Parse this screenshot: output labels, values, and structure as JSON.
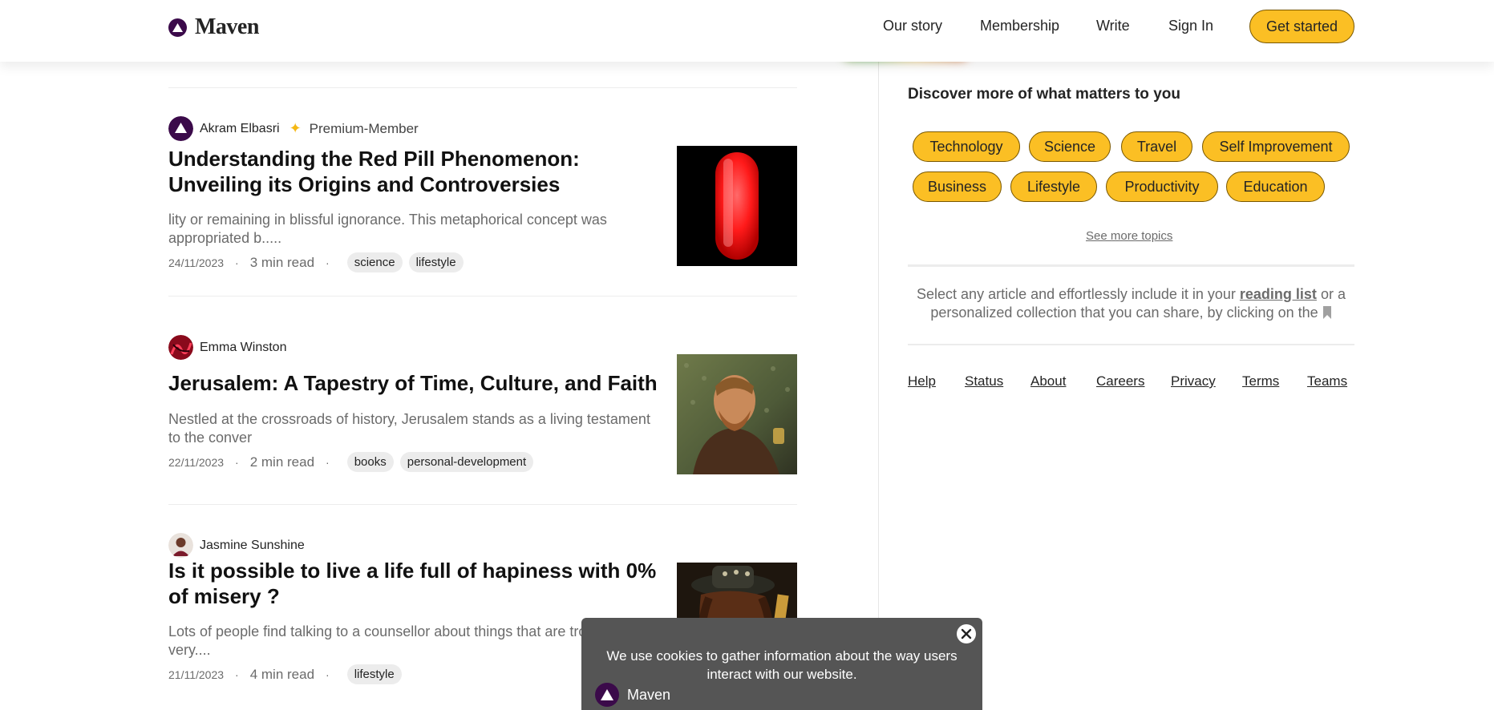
{
  "header": {
    "brand": "Maven",
    "nav": [
      {
        "label": "Our story"
      },
      {
        "label": "Membership"
      },
      {
        "label": "Write"
      },
      {
        "label": "Sign In"
      }
    ],
    "cta": "Get started"
  },
  "posts": [
    {
      "author": "Akram Elbasri",
      "badge": "Premium-Member",
      "title": "Understanding the Red Pill Phenomenon: Unveiling its Origins and Controversies",
      "excerpt": "lity or remaining in blissful ignorance. This metaphorical concept was appropriated b.....",
      "date": "24/11/2023",
      "read_time": "3 min read",
      "tags": [
        "science",
        "lifestyle"
      ],
      "image": "red-pill-image"
    },
    {
      "author": "Emma Winston",
      "title": "Jerusalem: A Tapestry of Time, Culture, and Faith",
      "excerpt": "Nestled at the crossroads of history, Jerusalem stands as a living testament to the conver",
      "date": "22/11/2023",
      "read_time": "2 min read",
      "tags": [
        "books",
        "personal-development"
      ],
      "image": "man-portrait-image"
    },
    {
      "author": "Jasmine Sunshine",
      "title": "Is it possible to live a life full of hapiness with 0% of misery ?",
      "excerpt": "Lots of people find talking to a counsellor about things that are troubling them very....",
      "date": "21/11/2023",
      "read_time": "4 min read",
      "tags": [
        "lifestyle"
      ],
      "image": "guitarist-image"
    }
  ],
  "meta_separator": "·",
  "sidebar": {
    "title": "Discover more of what matters to you",
    "topics": [
      "Technology",
      "Science",
      "Travel",
      "Self Improvement",
      "Business",
      "Lifestyle",
      "Productivity",
      "Education"
    ],
    "see_more": "See more topics",
    "note_before": "Select any article and effortlessly include it in your",
    "note_link": "reading list",
    "note_after": "or a personalized collection that you can share, by clicking on the",
    "footer": [
      "Help",
      "Status",
      "About",
      "Careers",
      "Privacy",
      "Terms",
      "Teams"
    ]
  },
  "cookie": {
    "text": "We use cookies to gather information about the way users interact with our website.",
    "brand": "Maven"
  },
  "colors": {
    "accent": "#fbbf24",
    "brand_dark": "#3b0a4a",
    "cookie_bg": "#555555"
  }
}
